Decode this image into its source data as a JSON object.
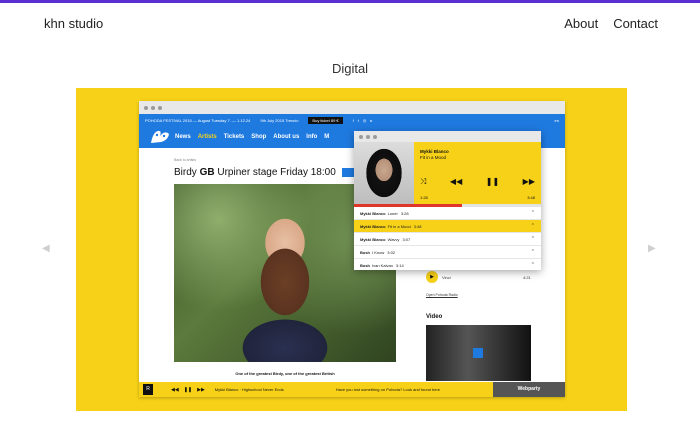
{
  "site": {
    "brand": "khn studio",
    "nav": [
      "About",
      "Contact"
    ],
    "section_title": "Digital"
  },
  "carousel": {
    "prev_icon": "triangle-left",
    "next_icon": "triangle-right",
    "stage_color": "#f7d117"
  },
  "mockup": {
    "topbar": {
      "info": "POHODA FESTIVAL 2015 — August Tuesday 7. — 1.12.24",
      "date": "9th July 2015 Trencin",
      "ticket": "Buy ticket 89 €",
      "lang": "en"
    },
    "nav": [
      "News",
      "Artists",
      "Tickets",
      "Shop",
      "About us",
      "Info",
      "M"
    ],
    "nav_active": "Artists",
    "back_link": "Back to artists",
    "headline_prefix": "Birdy",
    "headline_country": "GB",
    "headline_rest": "Urpiner stage Friday 18:00",
    "caption": "One of the greatest Birdy, one of the greatest British",
    "side_track": "Vinci",
    "side_time": "4:21",
    "side_link": "Open Pohoda Radio",
    "video_heading": "Video",
    "player_bar": {
      "badge": "R",
      "track": "Mykki Blanco · Highschool Never Ends",
      "message": "Have you lost something on Pohoda? Look and found here",
      "cta": "Webparty"
    }
  },
  "popup": {
    "artist": "Mykki Blanco",
    "song": "Fit in a Mood",
    "time_elapsed": "1:28",
    "time_total": "3:48",
    "progress": 0.58,
    "playlist": [
      {
        "artist": "Mykki Blanco",
        "title": "Loner",
        "duration": "3:28",
        "active": false
      },
      {
        "artist": "Mykki Blanco",
        "title": "Fit in a Mood",
        "duration": "3:48",
        "active": true
      },
      {
        "artist": "Mykki Blanco",
        "title": "Wavvy",
        "duration": "3:07",
        "active": false
      },
      {
        "artist": "Bosh",
        "title": "I Know",
        "duration": "3:02",
        "active": false
      },
      {
        "artist": "Bosh",
        "title": "Ivan Kalvan",
        "duration": "3:14",
        "active": false
      }
    ]
  }
}
